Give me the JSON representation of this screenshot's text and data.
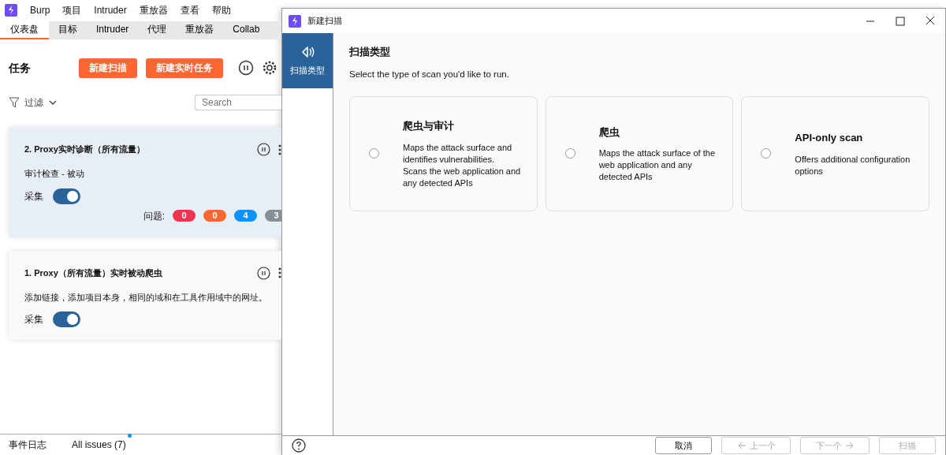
{
  "main": {
    "menu": [
      "Burp",
      "项目",
      "Intruder",
      "重放器",
      "查看",
      "帮助"
    ],
    "tabs": [
      {
        "label": "仪表盘",
        "selected": true
      },
      {
        "label": "目标",
        "selected": false
      },
      {
        "label": "Intruder",
        "selected": false
      },
      {
        "label": "代理",
        "selected": false
      },
      {
        "label": "重放器",
        "selected": false
      },
      {
        "label": "Collab",
        "selected": false
      }
    ],
    "tasks_title": "任务",
    "buttons": [
      "新建扫描",
      "新建实时任务"
    ],
    "filter": "过滤",
    "search": {
      "placeholder": "Search"
    },
    "tasks": [
      {
        "title": "2. Proxy实时诊断（所有流量）",
        "description": "审计检查 - 被动",
        "toggle_label": "采集",
        "on": true,
        "selected": true,
        "issues_label": "问题:",
        "issues": [
          {
            "count": "0",
            "color": "#f0344f"
          },
          {
            "count": "0",
            "color": "#ff6633"
          },
          {
            "count": "4",
            "color": "#0a93ff"
          },
          {
            "count": "3",
            "color": "#888e96"
          }
        ]
      },
      {
        "title": "1. Proxy（所有流量）实时被动爬虫",
        "description": "添加链接，添加项目本身，相同的域和在工具作用域中的网址。",
        "toggle_label": "采集",
        "on": true,
        "selected": false
      }
    ],
    "footer_tabs": [
      {
        "label": "事件日志",
        "dot": false
      },
      {
        "label": "All issues (7)",
        "dot": true
      }
    ]
  },
  "dialog": {
    "title": "新建扫描",
    "sidebar": [
      {
        "label": "扫描类型",
        "selected": true
      }
    ],
    "heading": "扫描类型",
    "intro": "Select the type of scan you'd like to run.",
    "scan_types": [
      {
        "title": "爬虫与审计",
        "description": "Maps the attack surface and identifies vulnerabilities. Scans the web application and any detected APIs",
        "selected": false
      },
      {
        "title": "爬虫",
        "description": "Maps the attack surface of the web application and any detected APIs",
        "selected": false
      },
      {
        "title": "API-only scan",
        "description": "Offers additional configuration options",
        "selected": false
      }
    ],
    "buttons": [
      {
        "label": "取消",
        "disabled": false,
        "kind": "cancel"
      },
      {
        "label": "上一个",
        "disabled": true,
        "kind": "back"
      },
      {
        "label": "下一个",
        "disabled": true,
        "kind": "next"
      },
      {
        "label": "扫描",
        "disabled": true,
        "kind": "scan"
      }
    ]
  }
}
